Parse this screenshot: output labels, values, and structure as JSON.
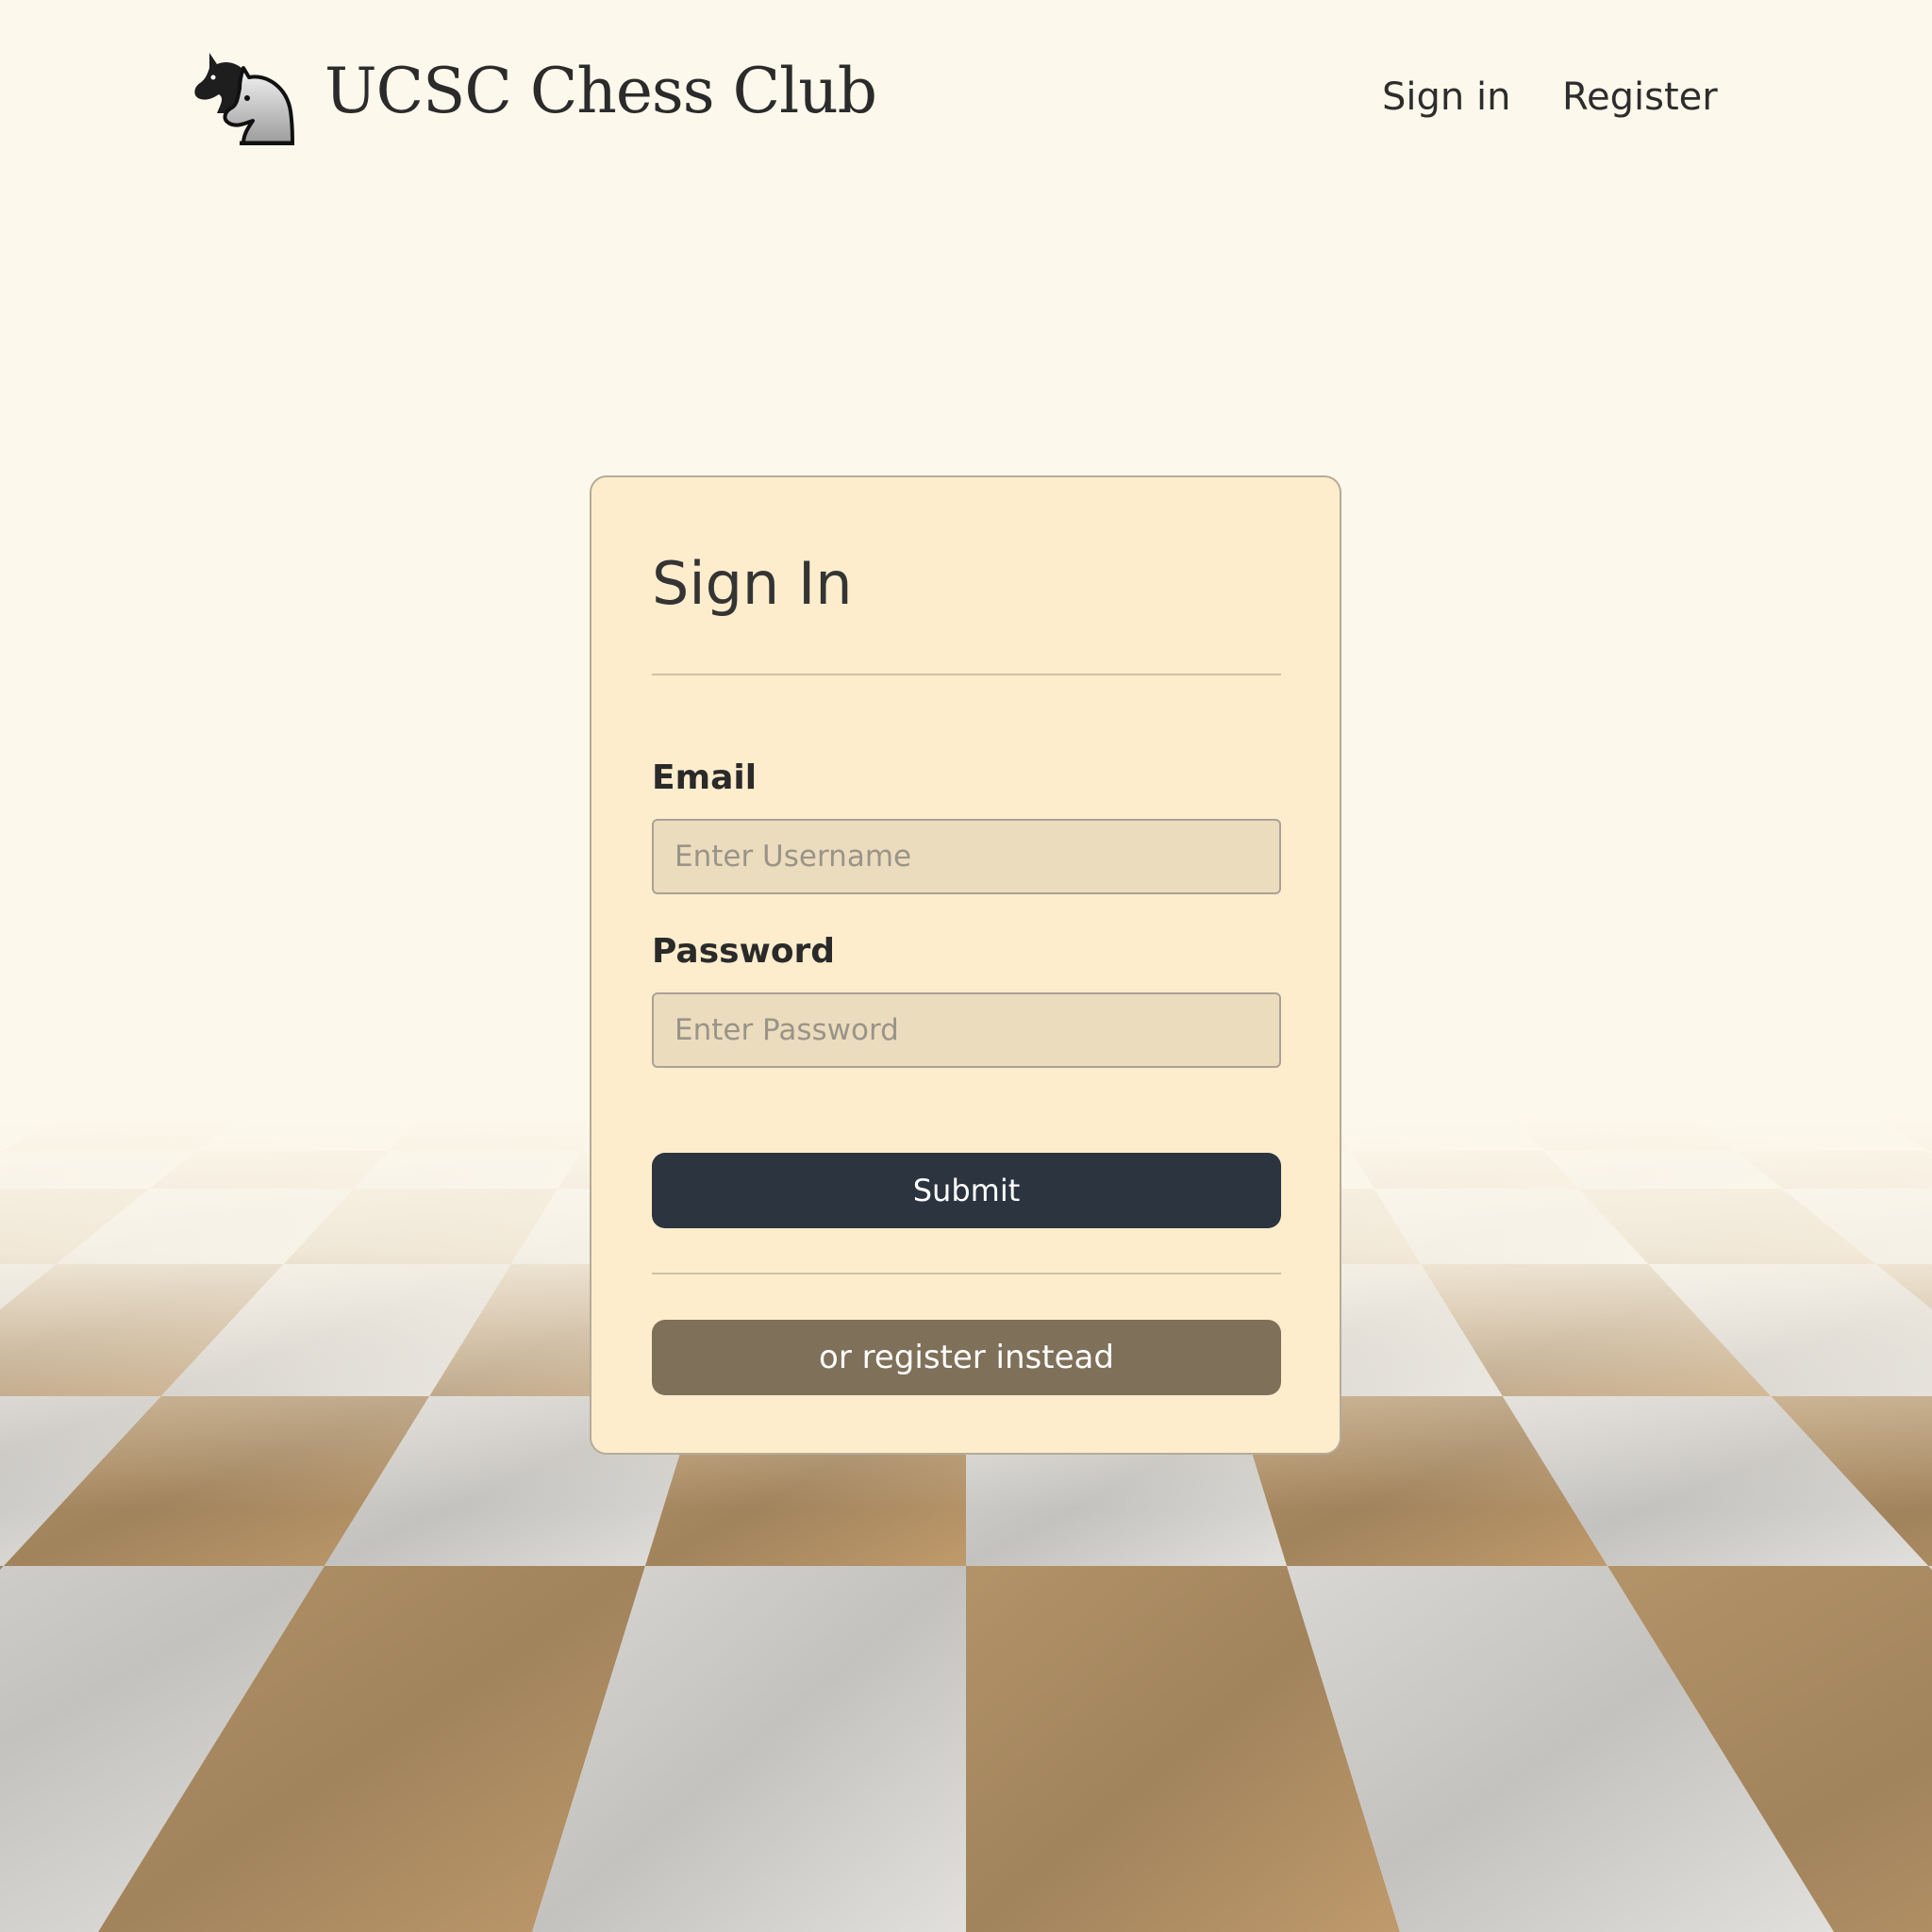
{
  "header": {
    "site_title": "UCSC Chess Club",
    "logo_icon": "chess-knights-logo-icon",
    "nav": {
      "sign_in": "Sign in",
      "register": "Register"
    }
  },
  "signin_form": {
    "title": "Sign In",
    "email_label": "Email",
    "email_placeholder": "Enter Username",
    "email_value": "",
    "password_label": "Password",
    "password_placeholder": "Enter Password",
    "password_value": "",
    "submit_label": "Submit",
    "register_label": "or register instead"
  },
  "colors": {
    "page_background": "#fdf8ec",
    "card_background": "#feedcc",
    "input_background": "#ecdcbe",
    "submit_button": "#2b343f",
    "register_button": "#7f705a",
    "text_dark": "#2b2b2b",
    "floor_light": "#cfcdca",
    "floor_dark": "#a98a63"
  }
}
